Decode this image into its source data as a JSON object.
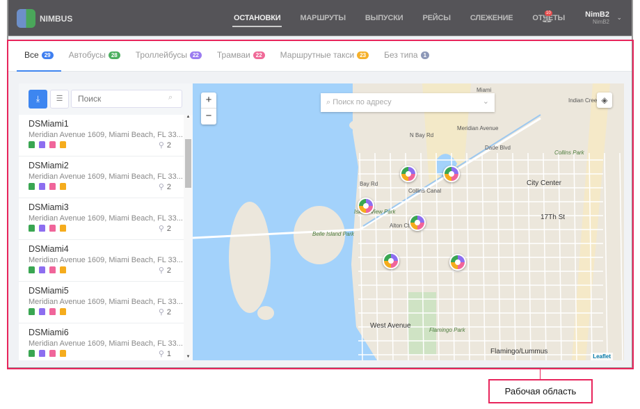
{
  "header": {
    "brand": "NIMBUS",
    "nav": [
      "ОСТАНОВКИ",
      "МАРШРУТЫ",
      "ВЫПУСКИ",
      "РЕЙСЫ",
      "СЛЕЖЕНИЕ",
      "ОТЧЕТЫ"
    ],
    "active_nav": "ОСТАНОВКИ",
    "notifications": "10",
    "user_name": "NimB2",
    "user_sub": "NimB2"
  },
  "tabs": [
    {
      "label": "Все",
      "count": "29",
      "color": "#3f7ff0"
    },
    {
      "label": "Автобусы",
      "count": "28",
      "color": "#4caf60"
    },
    {
      "label": "Троллейбусы",
      "count": "22",
      "color": "#9b7cf0"
    },
    {
      "label": "Трамваи",
      "count": "22",
      "color": "#f06a98"
    },
    {
      "label": "Маршрутные такси",
      "count": "23",
      "color": "#f5b02a"
    },
    {
      "label": "Без типа",
      "count": "1",
      "color": "#8d98b8"
    }
  ],
  "panel": {
    "search_placeholder": "Поиск",
    "stops": [
      {
        "name": "DSMiami1",
        "address": "Meridian Avenue 1609, Miami Beach, FL 33...",
        "routes": "2"
      },
      {
        "name": "DSMiami2",
        "address": "Meridian Avenue 1609, Miami Beach, FL 33...",
        "routes": "2"
      },
      {
        "name": "DSMiami3",
        "address": "Meridian Avenue 1609, Miami Beach, FL 33...",
        "routes": "2"
      },
      {
        "name": "DSMiami4",
        "address": "Meridian Avenue 1609, Miami Beach, FL 33...",
        "routes": "2"
      },
      {
        "name": "DSMiami5",
        "address": "Meridian Avenue 1609, Miami Beach, FL 33...",
        "routes": "2"
      },
      {
        "name": "DSMiami6",
        "address": "Meridian Avenue 1609, Miami Beach, FL 33...",
        "routes": "1"
      }
    ]
  },
  "map": {
    "address_placeholder": "Поиск по адресу",
    "zoom_in": "+",
    "zoom_out": "−",
    "attribution": "Leaflet",
    "labels": [
      "City Center",
      "West Avenue",
      "Flamingo/Lummus",
      "17Th St",
      "Collins Park",
      "Belle Island Park",
      "Island View Park",
      "Flamingo Park",
      "Miami",
      "N Bay Rd",
      "Bay Rd",
      "Alton Ct",
      "Meridian Avenue",
      "Dade Blvd",
      "Collins Canal",
      "Indian Creek"
    ]
  },
  "annotation": "Рабочая область"
}
